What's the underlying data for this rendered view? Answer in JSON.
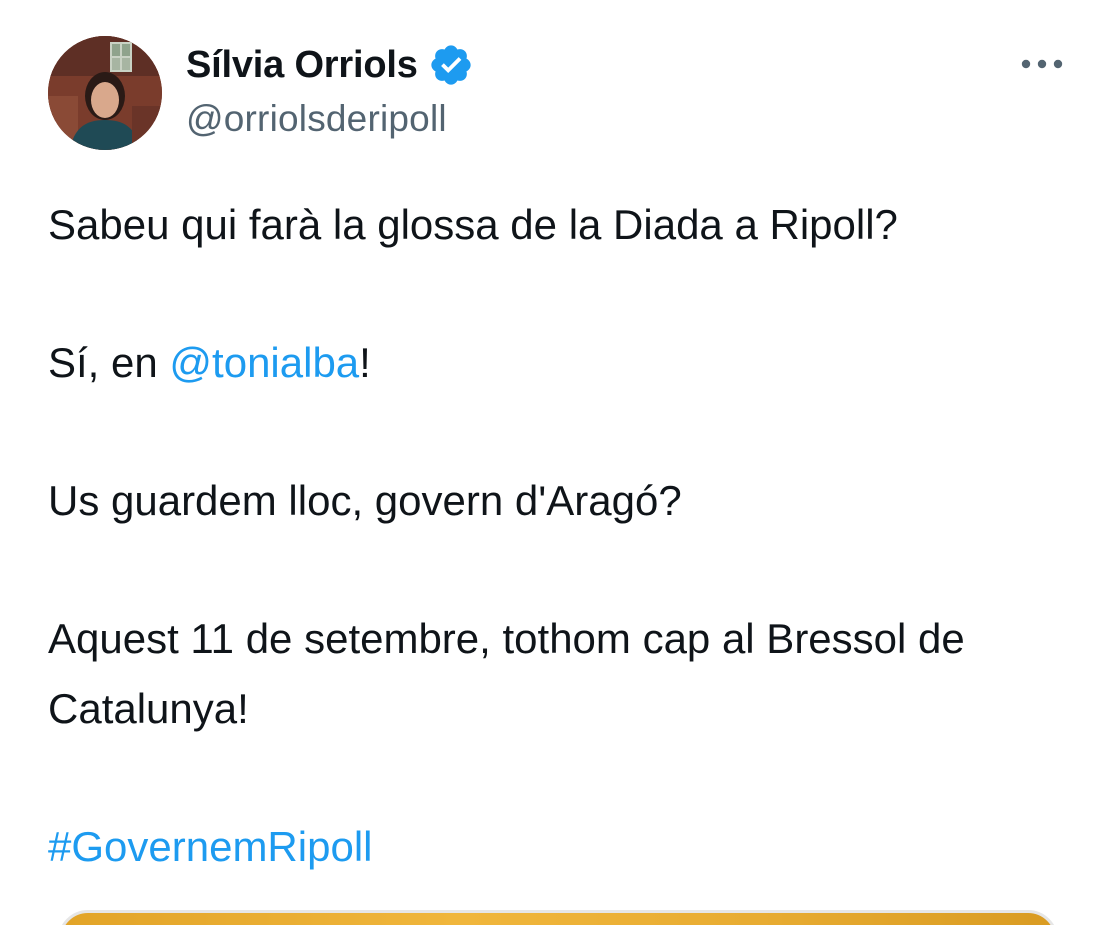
{
  "author": {
    "name": "Sílvia Orriols",
    "handle": "@orriolsderipoll",
    "verified": true
  },
  "icons": {
    "verified": "verified-badge-icon",
    "more": "more-horizontal-icon"
  },
  "colors": {
    "link": "#1d9bf0",
    "text": "#0f1419",
    "secondary": "#536471"
  },
  "tweet": {
    "line1": "Sabeu qui farà la glossa de la Diada a Ripoll?",
    "line2_prefix": "Sí, en ",
    "line2_mention": "@tonialba",
    "line2_suffix": "!",
    "line3": "Us guardem lloc, govern d'Aragó?",
    "line4": "Aquest 11 de setembre, tothom cap al Bressol de Catalunya!",
    "hashtag": "#GovernemRipoll"
  }
}
